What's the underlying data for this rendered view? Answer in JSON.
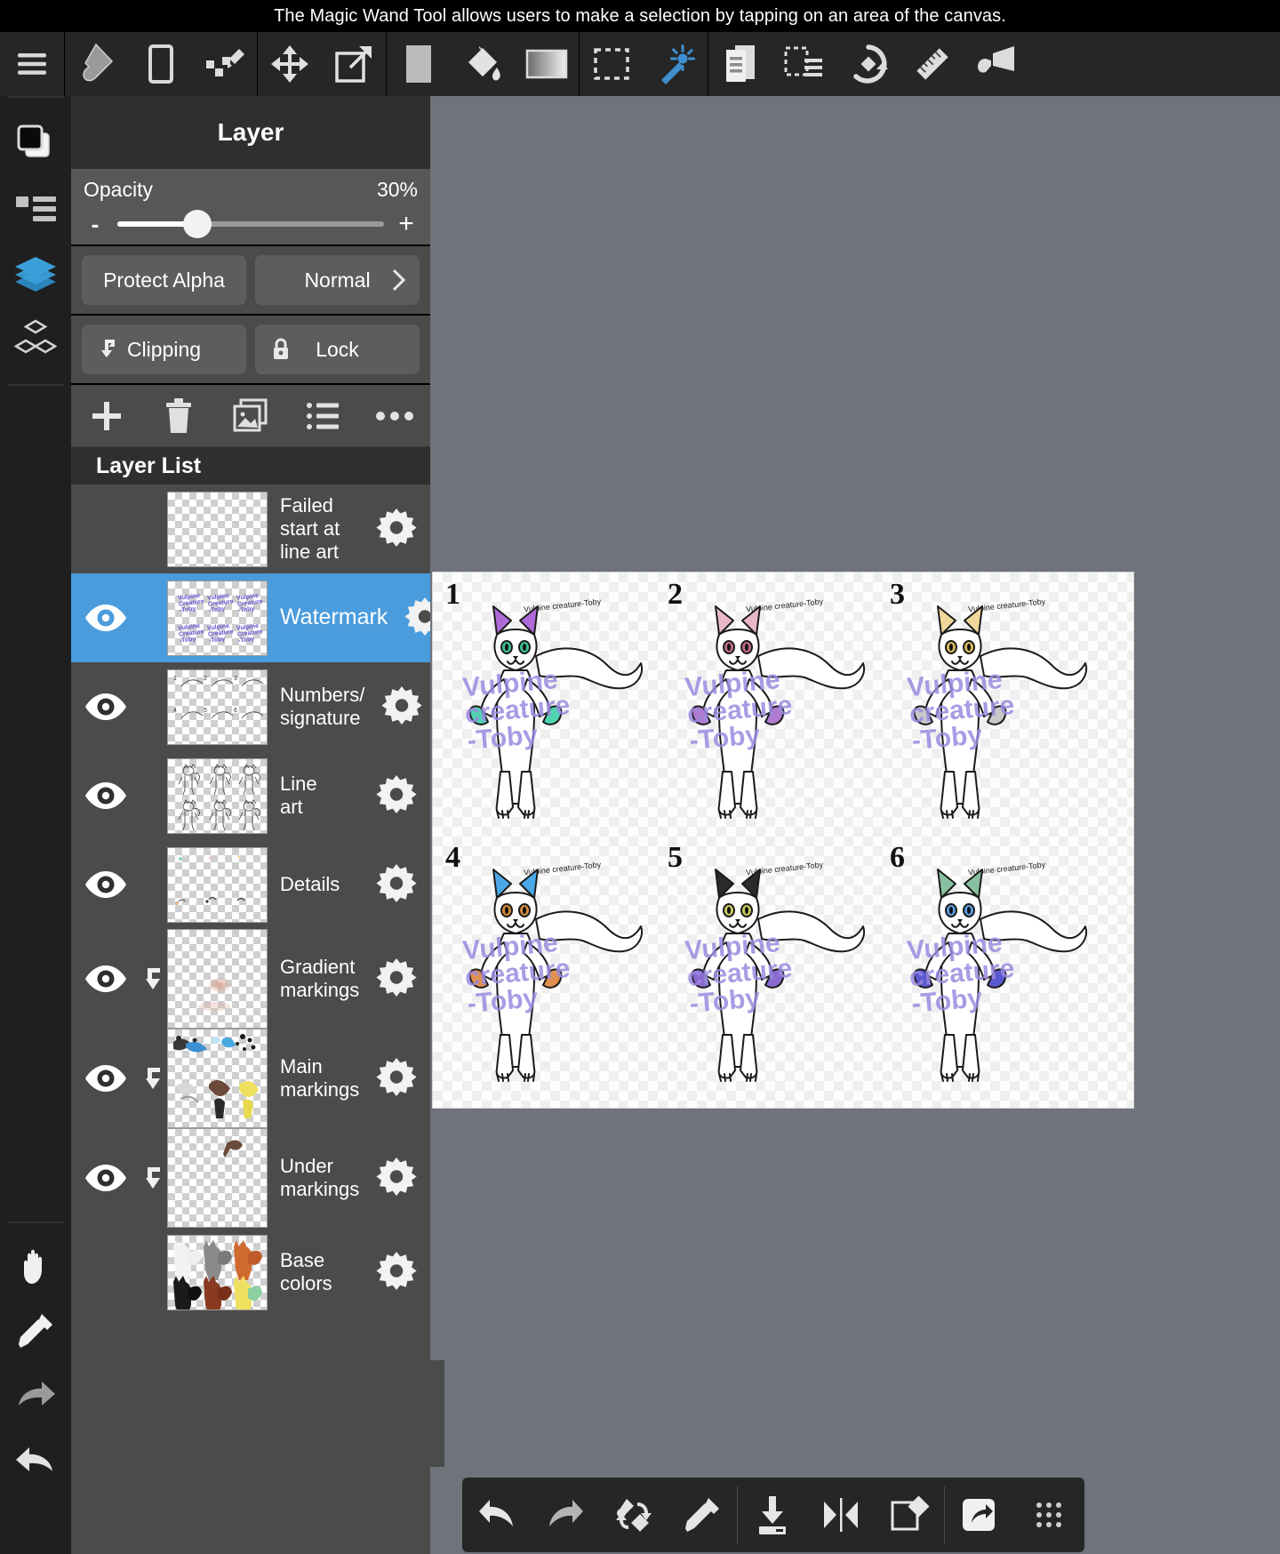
{
  "hint": {
    "text": "The Magic Wand Tool allows users to make a selection by tapping on an area of the canvas."
  },
  "top_toolbar": {
    "groups": [
      {
        "items": [
          {
            "name": "menu-icon",
            "label": "Menu"
          }
        ]
      },
      {
        "items": [
          {
            "name": "brush-icon",
            "label": "Brush"
          },
          {
            "name": "eraser-icon",
            "label": "Eraser"
          },
          {
            "name": "smudge-icon",
            "label": "Smudge"
          }
        ]
      },
      {
        "items": [
          {
            "name": "move-icon",
            "label": "Move"
          },
          {
            "name": "transform-icon",
            "label": "Transform"
          }
        ]
      },
      {
        "items": [
          {
            "name": "color-swatch-icon",
            "label": "Color"
          },
          {
            "name": "bucket-fill-icon",
            "label": "Bucket"
          },
          {
            "name": "gradient-icon",
            "label": "Gradient"
          }
        ]
      },
      {
        "items": [
          {
            "name": "rect-select-icon",
            "label": "Select"
          },
          {
            "name": "magic-wand-icon",
            "label": "Magic Wand",
            "active": true
          }
        ]
      },
      {
        "items": [
          {
            "name": "canvas-icon",
            "label": "Canvas"
          },
          {
            "name": "selection-layer-icon",
            "label": "Selection"
          },
          {
            "name": "rotate-icon",
            "label": "Rotate"
          },
          {
            "name": "ruler-icon",
            "label": "Ruler"
          },
          {
            "name": "filter-icon",
            "label": "Filter"
          }
        ]
      }
    ]
  },
  "left_rail": {
    "top_items": [
      {
        "name": "color-palette-icon",
        "label": "Colors"
      },
      {
        "name": "brush-list-icon",
        "label": "Brushes"
      },
      {
        "name": "layers-icon",
        "label": "Layers",
        "active": true
      },
      {
        "name": "materials-icon",
        "label": "Materials"
      }
    ],
    "bottom_items": [
      {
        "name": "hand-pan-icon",
        "label": "Pan"
      },
      {
        "name": "eyedropper-icon",
        "label": "Eyedropper"
      },
      {
        "name": "redo-arrow-icon",
        "label": "Redo"
      },
      {
        "name": "undo-arrow-icon",
        "label": "Undo"
      }
    ]
  },
  "layer_panel": {
    "title": "Layer",
    "opacity": {
      "label": "Opacity",
      "value": "30%",
      "percent": 30,
      "minus_label": "-",
      "plus_label": "+"
    },
    "buttons": {
      "protect_alpha": "Protect Alpha",
      "blend_mode": "Normal",
      "clipping": "Clipping",
      "lock": "Lock"
    },
    "actions": [
      {
        "name": "add-layer-button",
        "label": "Add layer"
      },
      {
        "name": "delete-layer-button",
        "label": "Delete layer"
      },
      {
        "name": "duplicate-layer-button",
        "label": "Duplicate layer"
      },
      {
        "name": "layer-options-button",
        "label": "Layer options"
      },
      {
        "name": "more-options-button",
        "label": "More"
      }
    ],
    "list_header": "Layer List",
    "layers": [
      {
        "name": "Failed start at line art",
        "visible": false,
        "selected": false,
        "clipping": false,
        "thumb": "blank"
      },
      {
        "name": "Watermark",
        "visible": true,
        "selected": true,
        "clipping": false,
        "thumb": "watermark"
      },
      {
        "name": "Numbers/ signature",
        "visible": true,
        "selected": false,
        "clipping": false,
        "thumb": "numbers"
      },
      {
        "name": "Line art",
        "visible": true,
        "selected": false,
        "clipping": false,
        "thumb": "lineart"
      },
      {
        "name": "Details",
        "visible": true,
        "selected": false,
        "clipping": false,
        "thumb": "details"
      },
      {
        "name": "Gradient markings",
        "visible": true,
        "selected": false,
        "clipping": true,
        "thumb": "gradient"
      },
      {
        "name": "Main markings",
        "visible": true,
        "selected": false,
        "clipping": true,
        "thumb": "mainmark"
      },
      {
        "name": "Under markings",
        "visible": true,
        "selected": false,
        "clipping": true,
        "thumb": "undermark"
      },
      {
        "name": "Base colors",
        "visible": false,
        "selected": false,
        "clipping": false,
        "thumb": "basecolors"
      }
    ]
  },
  "canvas": {
    "watermark_text": "Vulpine\ncreature\n-Toby",
    "signature_text": "Vulpine creature-Toby",
    "characters": [
      {
        "number": "1",
        "ear_color": "#b06ad8",
        "paw_color": "#4fd4b0",
        "eye_color": "#3bbf96"
      },
      {
        "number": "2",
        "ear_color": "#e8b8c8",
        "paw_color": "#b07ad0",
        "eye_color": "#c06a8a"
      },
      {
        "number": "3",
        "ear_color": "#f0d89a",
        "paw_color": "#c8c8c8",
        "eye_color": "#d8b85a"
      },
      {
        "number": "4",
        "ear_color": "#4aa8e8",
        "paw_color": "#e09050",
        "eye_color": "#d08a3a"
      },
      {
        "number": "5",
        "ear_color": "#2a2a2a",
        "paw_color": "#8a6ad0",
        "eye_color": "#c8c860"
      },
      {
        "number": "6",
        "ear_color": "#8ac0a0",
        "paw_color": "#5a5ad0",
        "eye_color": "#5a9ad8"
      }
    ]
  },
  "bottom_bar": {
    "items": [
      {
        "name": "undo-button",
        "label": "Undo"
      },
      {
        "name": "redo-button",
        "label": "Redo"
      },
      {
        "name": "transform-tool-button",
        "label": "Transform"
      },
      {
        "name": "eyedropper-button",
        "label": "Eyedropper"
      },
      {
        "name": "import-button",
        "label": "Import"
      },
      {
        "name": "flip-horizontal-button",
        "label": "Flip horizontal"
      },
      {
        "name": "add-layer-quick-button",
        "label": "Add layer"
      },
      {
        "name": "share-button",
        "label": "Share"
      },
      {
        "name": "handle-grip-button",
        "label": "Move toolbar"
      }
    ]
  },
  "colors": {
    "accent": "#4a9cdd",
    "panel_bg": "#4b4b4b",
    "toolbar_bg": "#262626",
    "canvas_bg": "#6f737b",
    "watermark_purple": "#9b8ae0"
  }
}
